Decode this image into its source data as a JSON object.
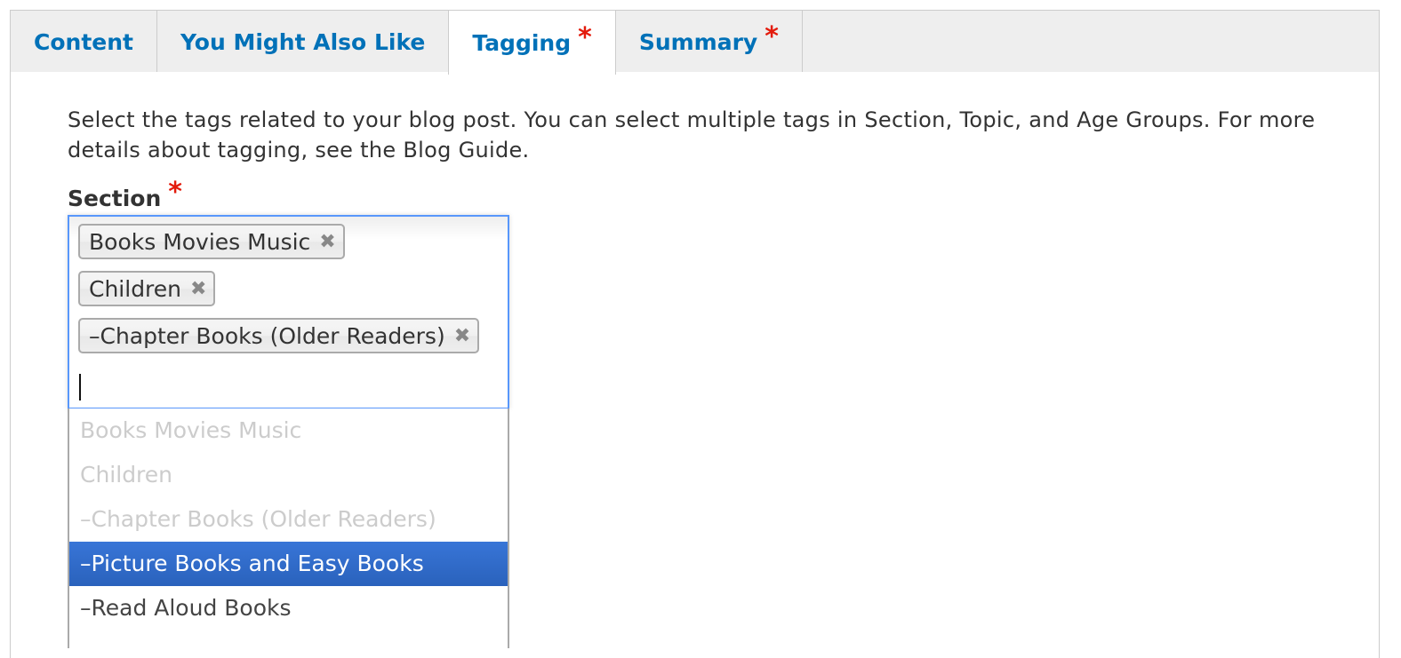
{
  "tabs": [
    {
      "label": "Content",
      "required": false,
      "active": false
    },
    {
      "label": "You Might Also Like",
      "required": false,
      "active": false
    },
    {
      "label": "Tagging",
      "required": true,
      "active": true
    },
    {
      "label": "Summary",
      "required": true,
      "active": false
    }
  ],
  "required_marker": "*",
  "description": "Select the tags related to your blog post. You can select multiple tags in Section, Topic, and Age Groups. For more details about tagging, see the Blog Guide.",
  "section": {
    "label": "Section",
    "required": true,
    "selected_choices": [
      {
        "label": "Books Movies Music",
        "remove_icon": "close-icon"
      },
      {
        "label": "Children",
        "remove_icon": "close-icon"
      },
      {
        "label": "–Chapter Books (Older Readers)",
        "remove_icon": "close-icon"
      }
    ],
    "remove_glyph": "✖",
    "search_value": "",
    "results": [
      {
        "label": "Books Movies Music",
        "state": "disabled"
      },
      {
        "label": "Children",
        "state": "disabled"
      },
      {
        "label": "–Chapter Books (Older Readers)",
        "state": "disabled"
      },
      {
        "label": "–Picture Books and Easy Books",
        "state": "highlighted"
      },
      {
        "label": "–Read Aloud Books",
        "state": "normal"
      }
    ]
  },
  "colors": {
    "tab_text": "#0071b8",
    "required": "#e31b0c",
    "focus_border": "#5897fb",
    "highlight": "#3875d7"
  }
}
